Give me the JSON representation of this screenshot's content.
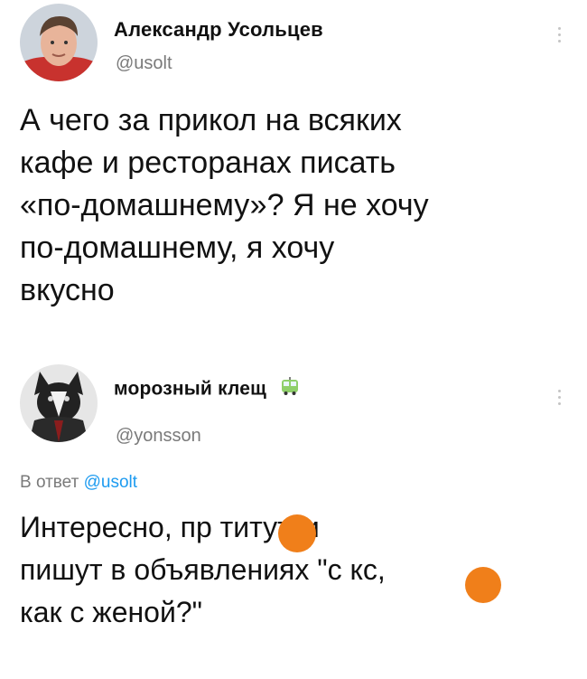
{
  "tweet1": {
    "author_name": "Александр Усольцев",
    "handle": "@usolt",
    "text": "А чего за прикол на всяких\nкафе и ресторанах писать\n«по-домашнему»? Я не хочу\nпо-домашнему, я хочу\nвкусно"
  },
  "tweet2": {
    "author_name": "морозный клещ",
    "name_icon": "bus-icon",
    "handle": "@yonsson",
    "reply_prefix": "В ответ",
    "reply_mention": "@usolt",
    "text": "Интересно, пр  титутки\nпишут в объявлениях \"с  кс,\nкак с женой?\""
  },
  "colors": {
    "text": "#111111",
    "secondary": "#7a7a7a",
    "link": "#1d9bf0",
    "censor_blot": "#f07f1a"
  }
}
